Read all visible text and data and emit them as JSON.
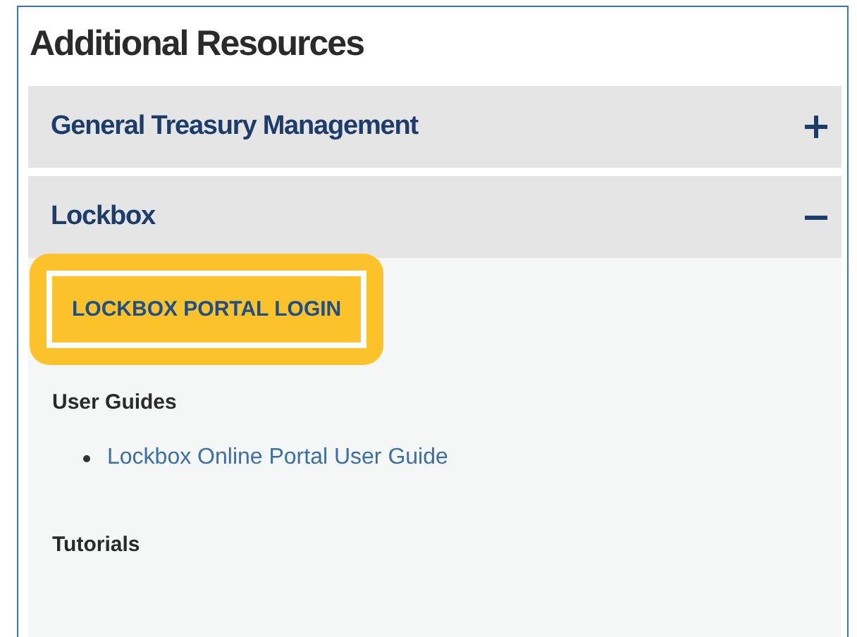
{
  "title": "Additional Resources",
  "sections": [
    {
      "title": "General Treasury Management",
      "expanded": false
    },
    {
      "title": "Lockbox",
      "expanded": true,
      "button": {
        "label": "LOCKBOX PORTAL LOGIN",
        "highlighted": true
      },
      "groups": [
        {
          "heading": "User Guides",
          "links": [
            "Lockbox Online Portal User Guide"
          ]
        },
        {
          "heading": "Tutorials"
        }
      ]
    }
  ]
}
